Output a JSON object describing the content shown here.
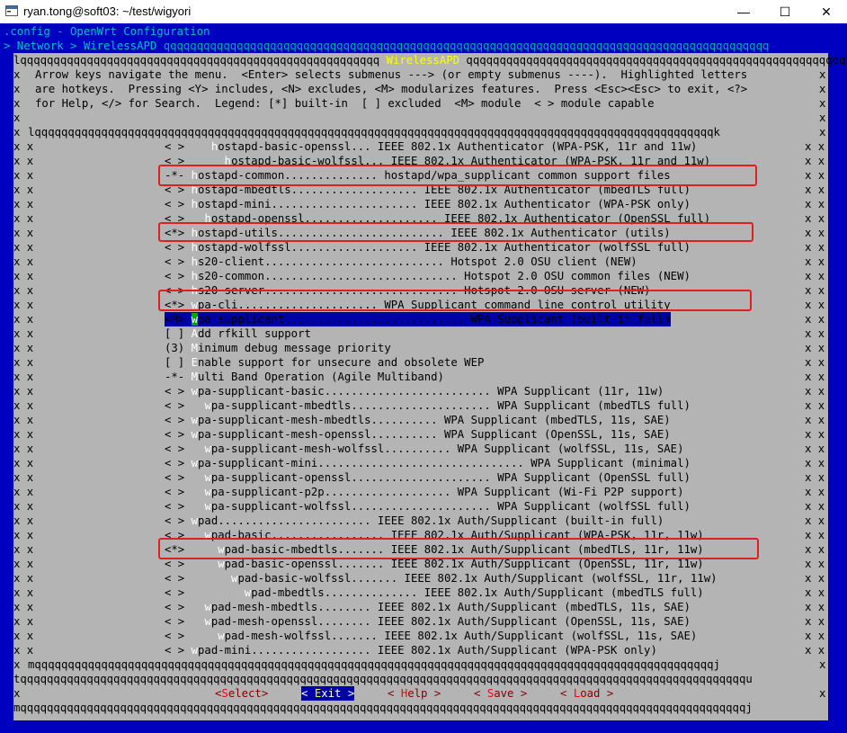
{
  "window": {
    "title": "ryan.tong@soft03: ~/test/wigyori",
    "minimize": "—",
    "maximize": "☐",
    "close": "✕"
  },
  "terminal": {
    "config_line": ".config - OpenWrt Configuration",
    "breadcrumb": "> Network > WirelessAPD",
    "menu_title": "WirelessAPD",
    "help": [
      "Arrow keys navigate the menu.  <Enter> selects submenus ---> (or empty submenus ----).  Highlighted letters",
      "are hotkeys.  Pressing <Y> includes, <N> excludes, <M> modularizes features.  Press <Esc><Esc> to exit, <?>",
      "for Help, </> for Search.  Legend: [*] built-in  [ ] excluded  <M> module  < > module capable"
    ],
    "items": [
      {
        "prefix": "< >",
        "indent": "   ",
        "hotkey": "h",
        "text": "ostapd-basic-openssl... IEEE 802.1x Authenticator (WPA-PSK, 11r and 11w)"
      },
      {
        "prefix": "< >",
        "indent": "     ",
        "hotkey": "h",
        "text": "ostapd-basic-wolfssl... IEEE 802.1x Authenticator (WPA-PSK, 11r and 11w)"
      },
      {
        "prefix": "-*-",
        "indent": "",
        "hotkey": "h",
        "text": "ostapd-common.............. hostapd/wpa_supplicant common support files"
      },
      {
        "prefix": "< >",
        "indent": "",
        "hotkey": "h",
        "text": "ostapd-mbedtls................... IEEE 802.1x Authenticator (mbedTLS full)"
      },
      {
        "prefix": "< >",
        "indent": "",
        "hotkey": "h",
        "text": "ostapd-mini...................... IEEE 802.1x Authenticator (WPA-PSK only)"
      },
      {
        "prefix": "< >",
        "indent": "  ",
        "hotkey": "h",
        "text": "ostapd-openssl.................... IEEE 802.1x Authenticator (OpenSSL full)"
      },
      {
        "prefix": "<*>",
        "indent": "",
        "hotkey": "h",
        "text": "ostapd-utils......................... IEEE 802.1x Authenticator (utils)"
      },
      {
        "prefix": "< >",
        "indent": "",
        "hotkey": "h",
        "text": "ostapd-wolfssl................... IEEE 802.1x Authenticator (wolfSSL full)"
      },
      {
        "prefix": "< >",
        "indent": "",
        "hotkey": "h",
        "text": "s20-client........................... Hotspot 2.0 OSU client (NEW)"
      },
      {
        "prefix": "< >",
        "indent": "",
        "hotkey": "h",
        "text": "s20-common............................. Hotspot 2.0 OSU common files (NEW)"
      },
      {
        "prefix": "< >",
        "indent": "",
        "hotkey": "h",
        "text": "s20-server............................. Hotspot 2.0 OSU server (NEW)"
      },
      {
        "prefix": "<*>",
        "indent": "",
        "hotkey": "w",
        "text": "pa-cli..................... WPA Supplicant command line control utility"
      },
      {
        "prefix": "<M>",
        "indent": "",
        "hotkey": "w",
        "text": "pa-supplicant........................... WPA Supplicant (built-in full)",
        "selected": true
      },
      {
        "prefix": "[ ]",
        "indent": "",
        "hotkey": "A",
        "text": "dd rfkill support"
      },
      {
        "prefix": "(3)",
        "indent": "",
        "hotkey": "M",
        "text": "inimum debug message priority"
      },
      {
        "prefix": "[ ]",
        "indent": "",
        "hotkey": "E",
        "text": "nable support for unsecure and obsolete WEP"
      },
      {
        "prefix": "-*-",
        "indent": "",
        "hotkey": "M",
        "text": "ulti Band Operation (Agile Multiband)"
      },
      {
        "prefix": "< >",
        "indent": "",
        "hotkey": "w",
        "text": "pa-supplicant-basic......................... WPA Supplicant (11r, 11w)"
      },
      {
        "prefix": "< >",
        "indent": "  ",
        "hotkey": "w",
        "text": "pa-supplicant-mbedtls..................... WPA Supplicant (mbedTLS full)"
      },
      {
        "prefix": "< >",
        "indent": "",
        "hotkey": "w",
        "text": "pa-supplicant-mesh-mbedtls.......... WPA Supplicant (mbedTLS, 11s, SAE)"
      },
      {
        "prefix": "< >",
        "indent": "",
        "hotkey": "w",
        "text": "pa-supplicant-mesh-openssl.......... WPA Supplicant (OpenSSL, 11s, SAE)"
      },
      {
        "prefix": "< >",
        "indent": "  ",
        "hotkey": "w",
        "text": "pa-supplicant-mesh-wolfssl.......... WPA Supplicant (wolfSSL, 11s, SAE)"
      },
      {
        "prefix": "< >",
        "indent": "",
        "hotkey": "w",
        "text": "pa-supplicant-mini............................... WPA Supplicant (minimal)"
      },
      {
        "prefix": "< >",
        "indent": "  ",
        "hotkey": "w",
        "text": "pa-supplicant-openssl..................... WPA Supplicant (OpenSSL full)"
      },
      {
        "prefix": "< >",
        "indent": "  ",
        "hotkey": "w",
        "text": "pa-supplicant-p2p................... WPA Supplicant (Wi-Fi P2P support)"
      },
      {
        "prefix": "< >",
        "indent": "  ",
        "hotkey": "w",
        "text": "pa-supplicant-wolfssl..................... WPA Supplicant (wolfSSL full)"
      },
      {
        "prefix": "< >",
        "indent": "",
        "hotkey": "w",
        "text": "pad....................... IEEE 802.1x Auth/Supplicant (built-in full)"
      },
      {
        "prefix": "< >",
        "indent": "  ",
        "hotkey": "w",
        "text": "pad-basic................. IEEE 802.1x Auth/Supplicant (WPA-PSK, 11r, 11w)"
      },
      {
        "prefix": "<*>",
        "indent": "    ",
        "hotkey": "w",
        "text": "pad-basic-mbedtls....... IEEE 802.1x Auth/Supplicant (mbedTLS, 11r, 11w)"
      },
      {
        "prefix": "< >",
        "indent": "    ",
        "hotkey": "w",
        "text": "pad-basic-openssl....... IEEE 802.1x Auth/Supplicant (OpenSSL, 11r, 11w)"
      },
      {
        "prefix": "< >",
        "indent": "      ",
        "hotkey": "w",
        "text": "pad-basic-wolfssl....... IEEE 802.1x Auth/Supplicant (wolfSSL, 11r, 11w)"
      },
      {
        "prefix": "< >",
        "indent": "        ",
        "hotkey": "w",
        "text": "pad-mbedtls.............. IEEE 802.1x Auth/Supplicant (mbedTLS full)"
      },
      {
        "prefix": "< >",
        "indent": "  ",
        "hotkey": "w",
        "text": "pad-mesh-mbedtls........ IEEE 802.1x Auth/Supplicant (mbedTLS, 11s, SAE)"
      },
      {
        "prefix": "< >",
        "indent": "  ",
        "hotkey": "w",
        "text": "pad-mesh-openssl........ IEEE 802.1x Auth/Supplicant (OpenSSL, 11s, SAE)"
      },
      {
        "prefix": "< >",
        "indent": "    ",
        "hotkey": "w",
        "text": "pad-mesh-wolfssl....... IEEE 802.1x Auth/Supplicant (wolfSSL, 11s, SAE)"
      },
      {
        "prefix": "< >",
        "indent": "",
        "hotkey": "w",
        "text": "pad-mini.................. IEEE 802.1x Auth/Supplicant (WPA-PSK only)"
      }
    ],
    "buttons": {
      "select": {
        "pre": "<",
        "hk": "S",
        "post": "elect>"
      },
      "exit": {
        "pre": "< ",
        "hk": "E",
        "post": "xit >"
      },
      "help": {
        "pre": "< ",
        "hk": "H",
        "post": "elp >"
      },
      "save": {
        "pre": "< ",
        "hk": "S",
        "post": "ave >"
      },
      "load": {
        "pre": "< ",
        "hk": "L",
        "post": "oad >"
      }
    }
  },
  "colors": {
    "terminal_bg": "#0000c0",
    "dialog_bg": "#b4b4b4",
    "selection": "#0000a8",
    "annotation": "#e02020"
  }
}
